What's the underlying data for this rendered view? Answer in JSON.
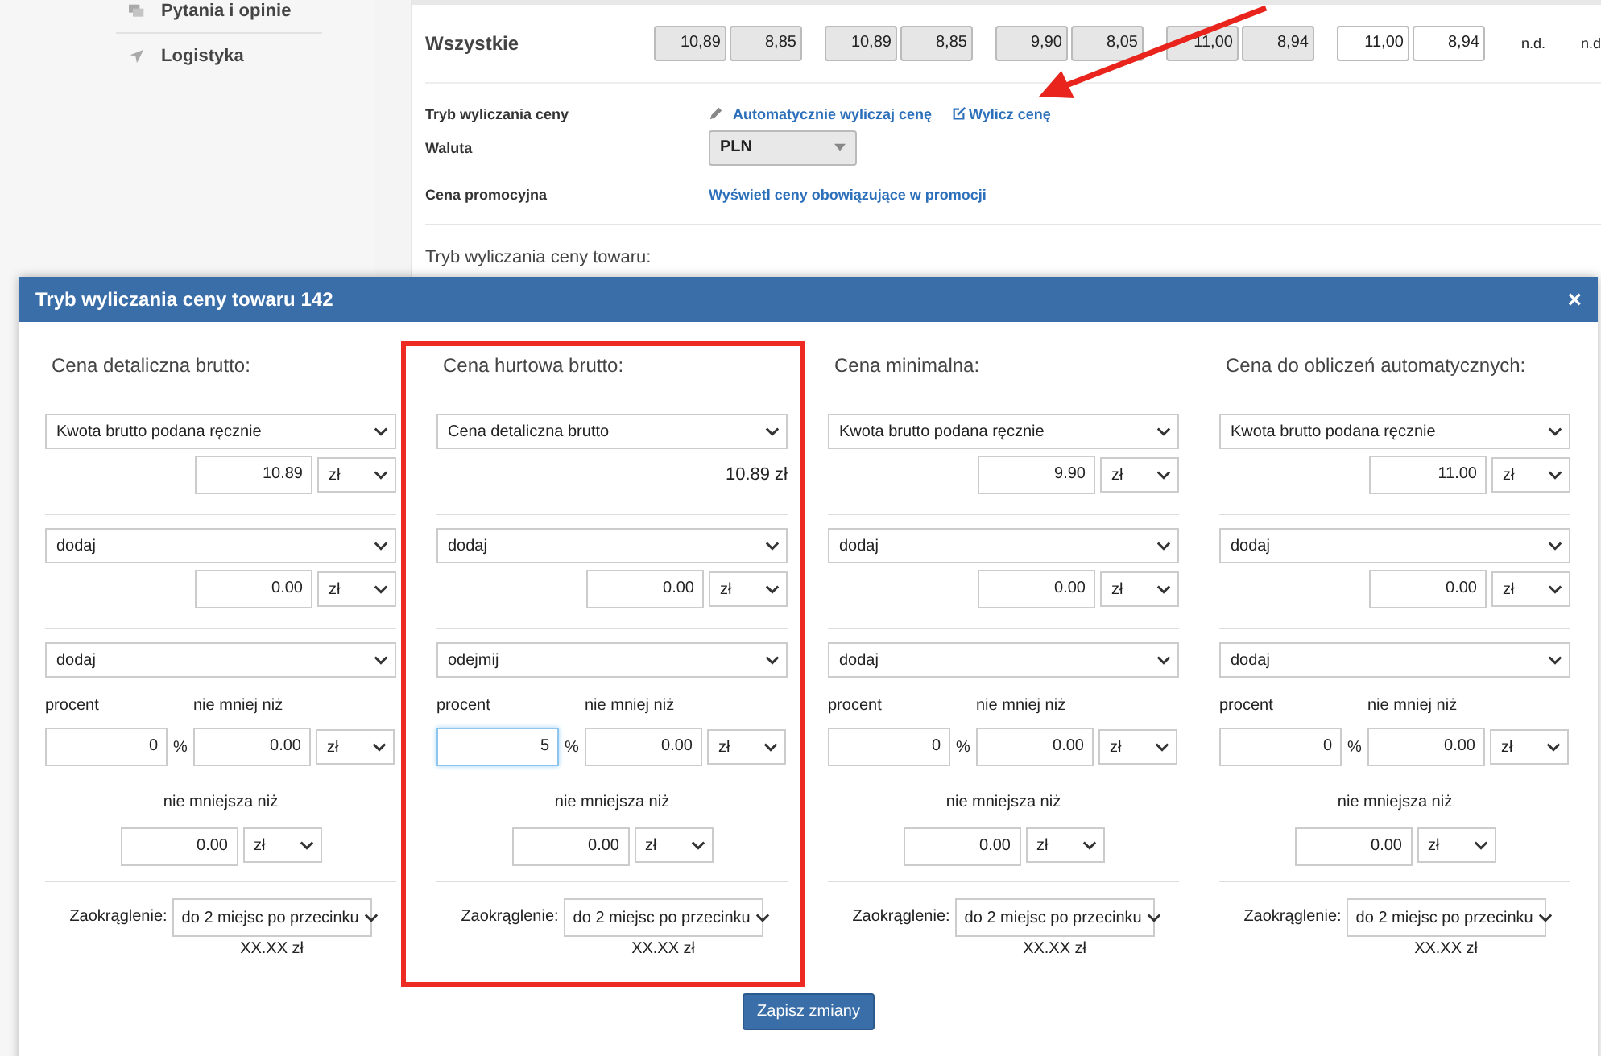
{
  "sidebar": {
    "items": [
      {
        "label": "Pytania i opinie"
      },
      {
        "label": "Logistyka"
      }
    ]
  },
  "prices": {
    "label": "Wszystkie",
    "groups": [
      {
        "values": [
          "10,89",
          "8,85"
        ],
        "disabled": true
      },
      {
        "values": [
          "10,89",
          "8,85"
        ],
        "disabled": true
      },
      {
        "values": [
          "9,90",
          "8,05"
        ],
        "disabled": true
      },
      {
        "values": [
          "11,00",
          "8,94"
        ],
        "disabled": true
      },
      {
        "values": [
          "11,00",
          "8,94"
        ],
        "disabled": false
      }
    ],
    "notes": [
      "n.d.",
      "n.d"
    ]
  },
  "settings": {
    "mode_label": "Tryb wyliczania ceny",
    "mode_links": [
      "Automatycznie wyliczaj cenę",
      "Wylicz cenę"
    ],
    "currency_label": "Waluta",
    "currency": "PLN",
    "promo_label": "Cena promocyjna",
    "promo_link": "Wyświetl ceny obowiązujące w promocji"
  },
  "section_title": "Tryb wyliczania ceny towaru:",
  "modal": {
    "title": "Tryb wyliczania ceny towaru 142",
    "close": "×",
    "columns": [
      {
        "title": "Cena detaliczna brutto:",
        "highlighted": false,
        "base_select": "Kwota brutto podana ręcznie",
        "base": {
          "kind": "input",
          "value": "10.89",
          "unit": "zł"
        },
        "add_select": "dodaj",
        "add_value": "0.00",
        "add_unit": "zł",
        "op_select": "dodaj",
        "percent_label": "procent",
        "min_label": "nie mniej niż",
        "percent": "0",
        "percent_focused": false,
        "percent_sign": "%",
        "min_value": "0.00",
        "min_unit": "zł",
        "floor_label": "nie mniejsza niż",
        "floor_value": "0.00",
        "floor_unit": "zł",
        "rounding_label": "Zaokrąglenie:",
        "rounding": "do 2 miejsc po przecinku",
        "rounding_example": "XX.XX zł"
      },
      {
        "title": "Cena hurtowa brutto:",
        "highlighted": true,
        "base_select": "Cena detaliczna brutto",
        "base": {
          "kind": "text",
          "text": "10.89 zł"
        },
        "add_select": "dodaj",
        "add_value": "0.00",
        "add_unit": "zł",
        "op_select": "odejmij",
        "percent_label": "procent",
        "min_label": "nie mniej niż",
        "percent": "5",
        "percent_focused": true,
        "percent_sign": "%",
        "min_value": "0.00",
        "min_unit": "zł",
        "floor_label": "nie mniejsza niż",
        "floor_value": "0.00",
        "floor_unit": "zł",
        "rounding_label": "Zaokrąglenie:",
        "rounding": "do 2 miejsc po przecinku",
        "rounding_example": "XX.XX zł"
      },
      {
        "title": "Cena minimalna:",
        "highlighted": false,
        "base_select": "Kwota brutto podana ręcznie",
        "base": {
          "kind": "input",
          "value": "9.90",
          "unit": "zł"
        },
        "add_select": "dodaj",
        "add_value": "0.00",
        "add_unit": "zł",
        "op_select": "dodaj",
        "percent_label": "procent",
        "min_label": "nie mniej niż",
        "percent": "0",
        "percent_focused": false,
        "percent_sign": "%",
        "min_value": "0.00",
        "min_unit": "zł",
        "floor_label": "nie mniejsza niż",
        "floor_value": "0.00",
        "floor_unit": "zł",
        "rounding_label": "Zaokrąglenie:",
        "rounding": "do 2 miejsc po przecinku",
        "rounding_example": "XX.XX zł"
      },
      {
        "title": "Cena do obliczeń automatycznych:",
        "highlighted": false,
        "base_select": "Kwota brutto podana ręcznie",
        "base": {
          "kind": "input",
          "value": "11.00",
          "unit": "zł"
        },
        "add_select": "dodaj",
        "add_value": "0.00",
        "add_unit": "zł",
        "op_select": "dodaj",
        "percent_label": "procent",
        "min_label": "nie mniej niż",
        "percent": "0",
        "percent_focused": false,
        "percent_sign": "%",
        "min_value": "0.00",
        "min_unit": "zł",
        "floor_label": "nie mniejsza niż",
        "floor_value": "0.00",
        "floor_unit": "zł",
        "rounding_label": "Zaokrąglenie:",
        "rounding": "do 2 miejsc po przecinku",
        "rounding_example": "XX.XX zł"
      }
    ],
    "save": "Zapisz zmiany"
  }
}
